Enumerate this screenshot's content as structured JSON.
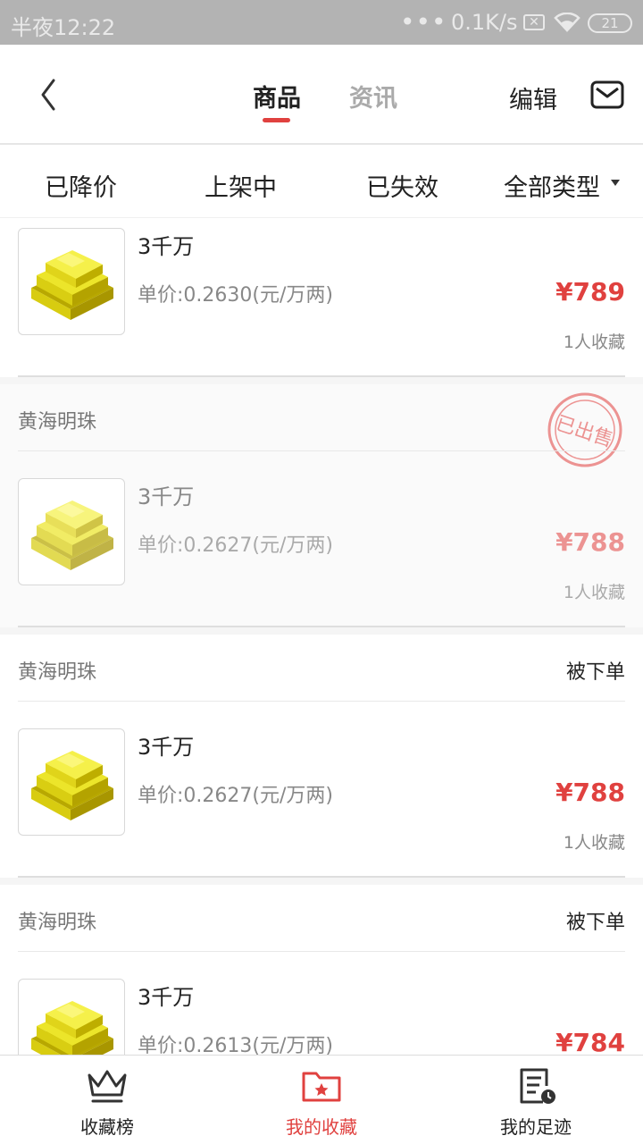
{
  "status_bar": {
    "time": "半夜12:22",
    "dots": "•••",
    "network_speed": "0.1K/s",
    "sim": "✕",
    "battery": "21"
  },
  "header": {
    "tabs": [
      "商品",
      "资讯"
    ],
    "active_tab": "商品",
    "edit_label": "编辑",
    "accent_color": "#e0413f"
  },
  "filters": [
    "已降价",
    "上架中",
    "已失效",
    "全部类型"
  ],
  "items": [
    {
      "seller": "",
      "status": "",
      "title": "3千万",
      "unit_price": "单价:0.2630(元/万两)",
      "price": "¥789",
      "collect": "1人收藏",
      "icon": "gold-bars-icon"
    },
    {
      "seller": "黄海明珠",
      "status": "",
      "stamp": "已出售",
      "title": "3千万",
      "unit_price": "单价:0.2627(元/万两)",
      "price": "¥788",
      "collect": "1人收藏",
      "icon": "gold-bars-icon"
    },
    {
      "seller": "黄海明珠",
      "status": "被下单",
      "title": "3千万",
      "unit_price": "单价:0.2627(元/万两)",
      "price": "¥788",
      "collect": "1人收藏",
      "icon": "gold-bars-icon"
    },
    {
      "seller": "黄海明珠",
      "status": "被下单",
      "title": "3千万",
      "unit_price": "单价:0.2613(元/万两)",
      "price": "¥784",
      "collect": "",
      "icon": "gold-bars-icon"
    }
  ],
  "bottom_nav": [
    {
      "label": "收藏榜",
      "icon": "crown-icon"
    },
    {
      "label": "我的收藏",
      "icon": "folder-star-icon",
      "active": true
    },
    {
      "label": "我的足迹",
      "icon": "history-icon"
    }
  ]
}
